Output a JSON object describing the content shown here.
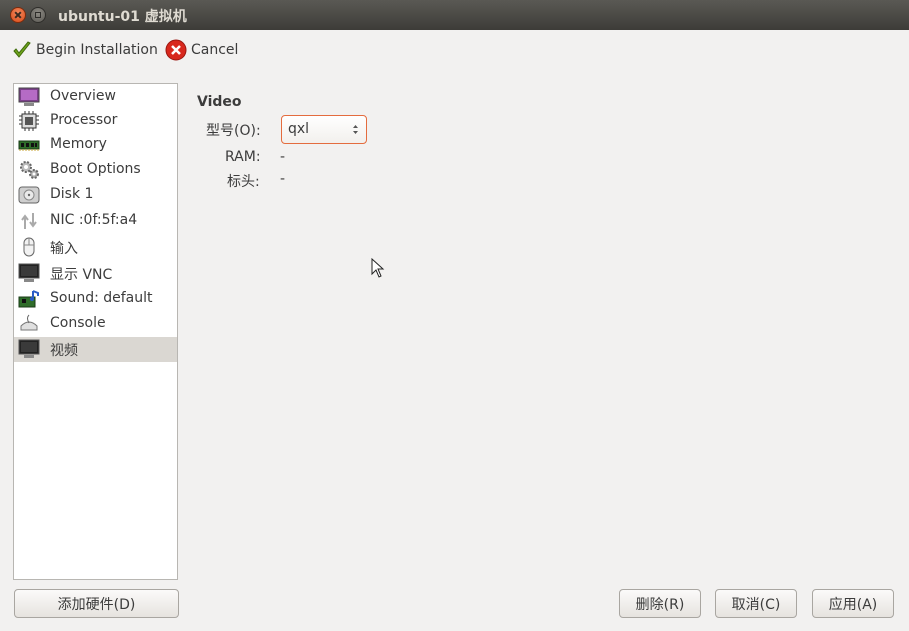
{
  "window": {
    "title": "ubuntu-01 虚拟机"
  },
  "toolbar": {
    "begin_label": "Begin Installation",
    "cancel_label": "Cancel"
  },
  "sidebar": {
    "items": [
      {
        "label": "Overview",
        "icon": "monitor-purple-icon"
      },
      {
        "label": "Processor",
        "icon": "cpu-icon"
      },
      {
        "label": "Memory",
        "icon": "ram-icon"
      },
      {
        "label": "Boot Options",
        "icon": "gears-icon"
      },
      {
        "label": "Disk 1",
        "icon": "hard-disk-icon"
      },
      {
        "label": "NIC :0f:5f:a4",
        "icon": "network-arrows-icon"
      },
      {
        "label": "输入",
        "icon": "mouse-icon"
      },
      {
        "label": "显示 VNC",
        "icon": "display-icon"
      },
      {
        "label": "Sound: default",
        "icon": "sound-card-icon"
      },
      {
        "label": "Console",
        "icon": "console-icon"
      },
      {
        "label": "视频",
        "icon": "video-monitor-icon"
      }
    ],
    "selected_index": 10
  },
  "detail": {
    "section_title": "Video",
    "model_label": "型号(O):",
    "model_value": "qxl",
    "ram_label": "RAM:",
    "ram_value": "-",
    "heads_label": "标头:",
    "heads_value": "-"
  },
  "buttons": {
    "add_hardware": "添加硬件(D)",
    "remove": "删除(R)",
    "cancel": "取消(C)",
    "apply": "应用(A)"
  },
  "colors": {
    "focus_border": "#e46c3e",
    "selected_row": "#dad7d2",
    "titlebar": "#3d3c38"
  }
}
